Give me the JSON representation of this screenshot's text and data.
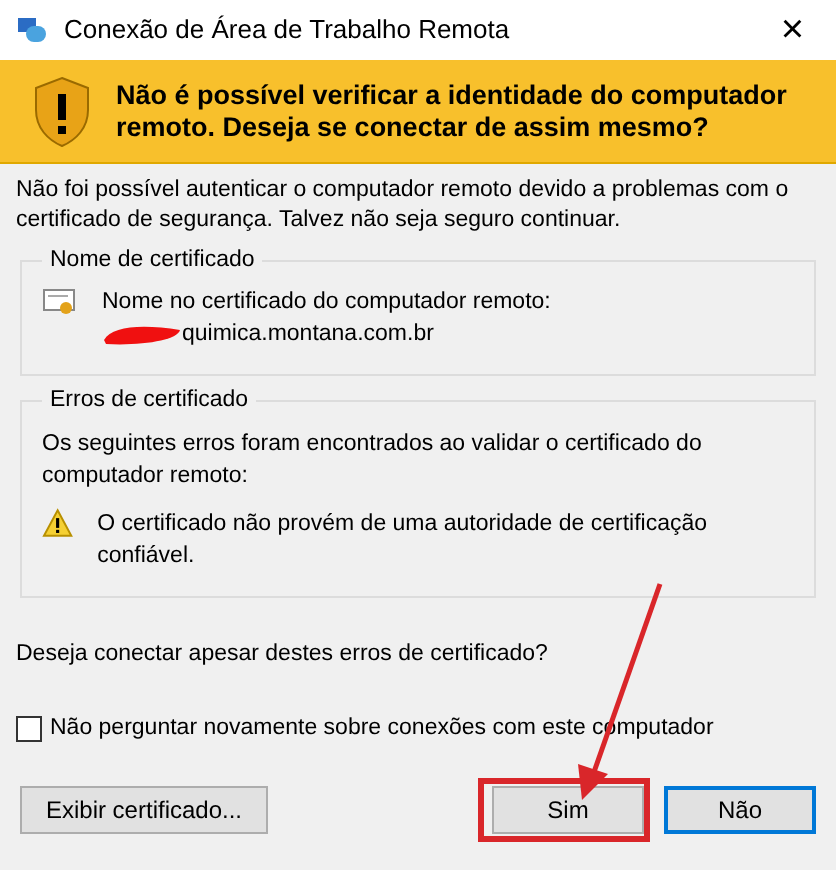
{
  "window": {
    "title": "Conexão de Área de Trabalho Remota",
    "close": "×"
  },
  "banner": {
    "text": "Não é possível verificar a identidade do computador remoto. Deseja se conectar de assim mesmo?"
  },
  "intro": "Não foi possível autenticar o computador remoto devido a problemas com o certificado de segurança. Talvez não seja seguro continuar.",
  "certificate_name": {
    "legend": "Nome de certificado",
    "label": "Nome no certificado do computador remoto:",
    "value": "quimica.montana.com.br"
  },
  "certificate_errors": {
    "legend": "Erros de certificado",
    "description": "Os seguintes erros foram encontrados ao validar o certificado do computador remoto:",
    "errors": [
      "O certificado não provém de uma autoridade de certificação confiável."
    ]
  },
  "question": "Deseja conectar apesar destes erros de certificado?",
  "dont_ask": {
    "label": "Não perguntar novamente sobre conexões com este computador",
    "checked": false
  },
  "buttons": [
    {
      "label": "Exibir certificado...",
      "highlighted": false,
      "default": false
    },
    {
      "label": "Sim",
      "highlighted": true,
      "default": false
    },
    {
      "label": "Não",
      "highlighted": false,
      "default": true
    }
  ]
}
